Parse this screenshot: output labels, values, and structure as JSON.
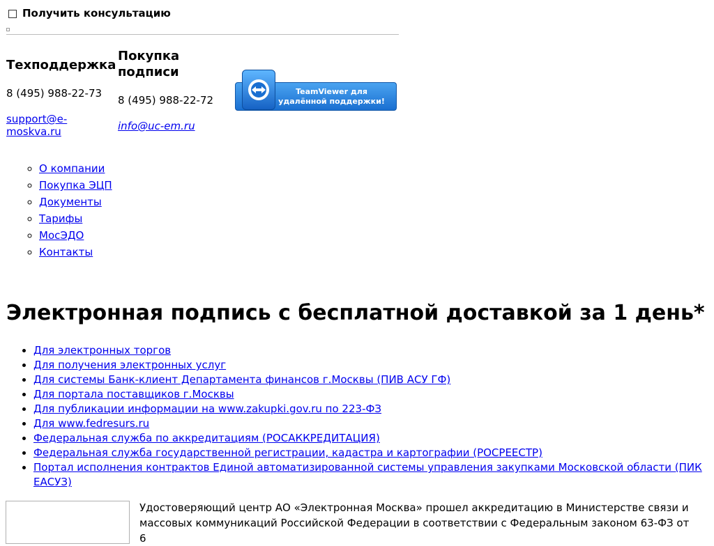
{
  "consult": {
    "label": "Получить консультацию"
  },
  "support": {
    "title": "Техподдержка",
    "phone": "8 (495) 988-22-73",
    "email": "support@e-moskva.ru"
  },
  "purchase": {
    "title": "Покупка подписи",
    "phone": "8 (495) 988-22-72",
    "email": "info@uc-em.ru"
  },
  "teamviewer": {
    "line1": "TeamViewer для",
    "line2": "удалённой поддержки!"
  },
  "nav": [
    {
      "label": "О компании"
    },
    {
      "label": "Покупка ЭЦП"
    },
    {
      "label": "Документы"
    },
    {
      "label": "Тарифы"
    },
    {
      "label": "МосЭДО"
    },
    {
      "label": "Контакты"
    }
  ],
  "main": {
    "title": "Электронная подпись с бесплатной доставкой за 1 день*",
    "services": [
      "Для электронных торгов",
      "Для получения электронных услуг",
      "Для системы Банк-клиент Департамента финансов г.Москвы (ПИВ АСУ ГФ)",
      "Для портала поставщиков г.Москвы",
      "Для публикации информации на www.zakupki.gov.ru по 223-ФЗ",
      "Для www.fedresurs.ru",
      "Федеральная служба по аккредитациям (РОСАККРЕДИТАЦИЯ)",
      "Федеральная служба государственной регистрации, кадастра и картографии (РОСРЕЕСТР)",
      "Портал исполнения контрактов Единой автоматизированной системы управления закупками Московской области (ПИК ЕАСУЗ)"
    ],
    "paragraph": "Удостоверяющий центр АО «Электронная Москва» прошел аккредитацию в Министерстве связи и массовых коммуникаций Российской Федерации в соответствии с Федеральным законом 63-ФЗ от 6"
  },
  "colors": {
    "link": "#0000ee",
    "tv_button_top": "#4aa3f0",
    "tv_button_bottom": "#1a6fd1",
    "rule": "#bdbdbd"
  }
}
